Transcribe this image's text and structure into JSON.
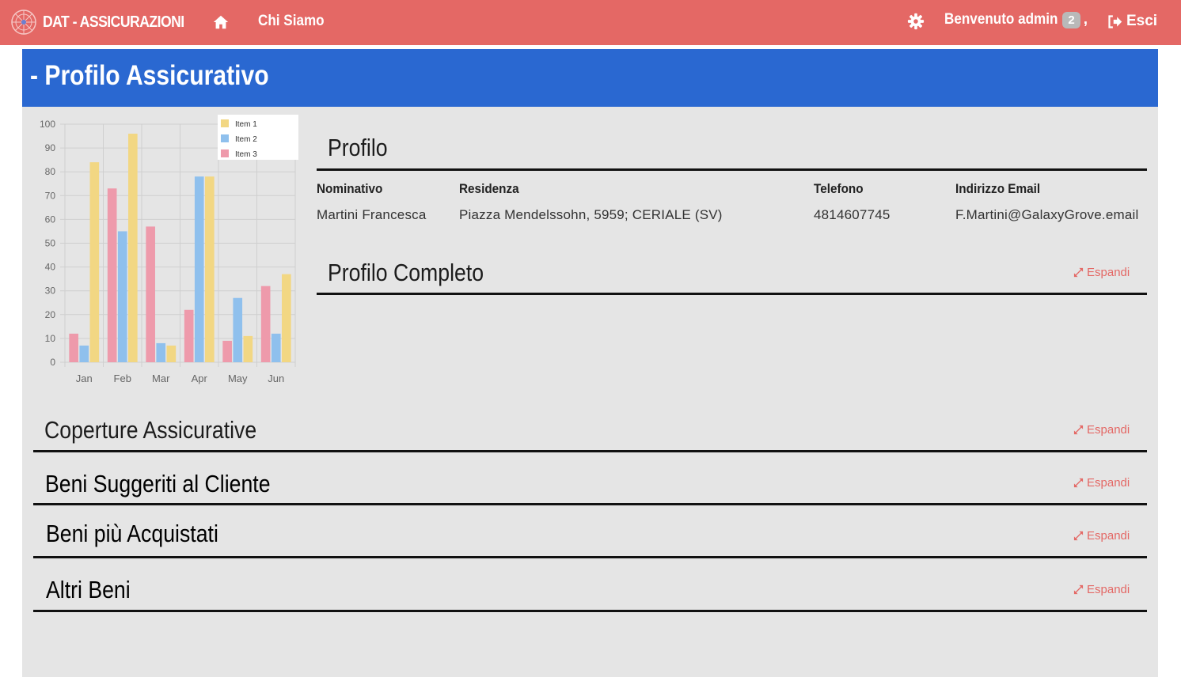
{
  "navbar": {
    "brand": "DAT - ASSICURAZIONI",
    "chi_siamo": "Chi Siamo",
    "welcome": "Benvenuto admin",
    "badge_count": "2",
    "separator": ",",
    "logout": "Esci",
    "icons": {
      "home": "home-icon",
      "settings": "gear-icon",
      "logout": "sign-out-icon"
    },
    "color": "#e46865"
  },
  "page": {
    "title": "- Profilo Assicurativo",
    "header_color": "#2a68d1",
    "background": "#e5e5e5"
  },
  "chart_data": {
    "type": "bar",
    "categories": [
      "Jan",
      "Feb",
      "Mar",
      "Apr",
      "May",
      "Jun"
    ],
    "series": [
      {
        "name": "Item 3",
        "color": "#ee9aab",
        "values": [
          12,
          73,
          57,
          22,
          9,
          32
        ]
      },
      {
        "name": "Item 2",
        "color": "#8fc0ed",
        "values": [
          7,
          55,
          8,
          78,
          27,
          12
        ]
      },
      {
        "name": "Item 1",
        "color": "#f2d783",
        "values": [
          84,
          96,
          7,
          78,
          11,
          37
        ]
      }
    ],
    "legend_order": [
      "Item 1",
      "Item 2",
      "Item 3"
    ],
    "legend_position": "top-right",
    "ylim": [
      0,
      100
    ],
    "yticks": [
      "0",
      "10",
      "20",
      "30",
      "40",
      "50",
      "60",
      "70",
      "80",
      "90",
      "100"
    ],
    "grid": true
  },
  "profilo": {
    "title": "Profilo",
    "headers": {
      "nominativo": "Nominativo",
      "residenza": "Residenza",
      "telefono": "Telefono",
      "email": "Indirizzo Email"
    },
    "values": {
      "nominativo": "Martini Francesca",
      "residenza": "Piazza Mendelssohn, 5959; CERIALE (SV)",
      "telefono": "4814607745",
      "email": "F.Martini@GalaxyGrove.email"
    }
  },
  "sections": {
    "profilo_completo": "Profilo Completo",
    "coperture": "Coperture Assicurative",
    "beni_suggeriti": "Beni Suggeriti al Cliente",
    "beni_acquistati": "Beni più Acquistati",
    "altri_beni": "Altri Beni",
    "expand_label": "Espandi",
    "expand_icon": "expand-arrows-icon"
  }
}
